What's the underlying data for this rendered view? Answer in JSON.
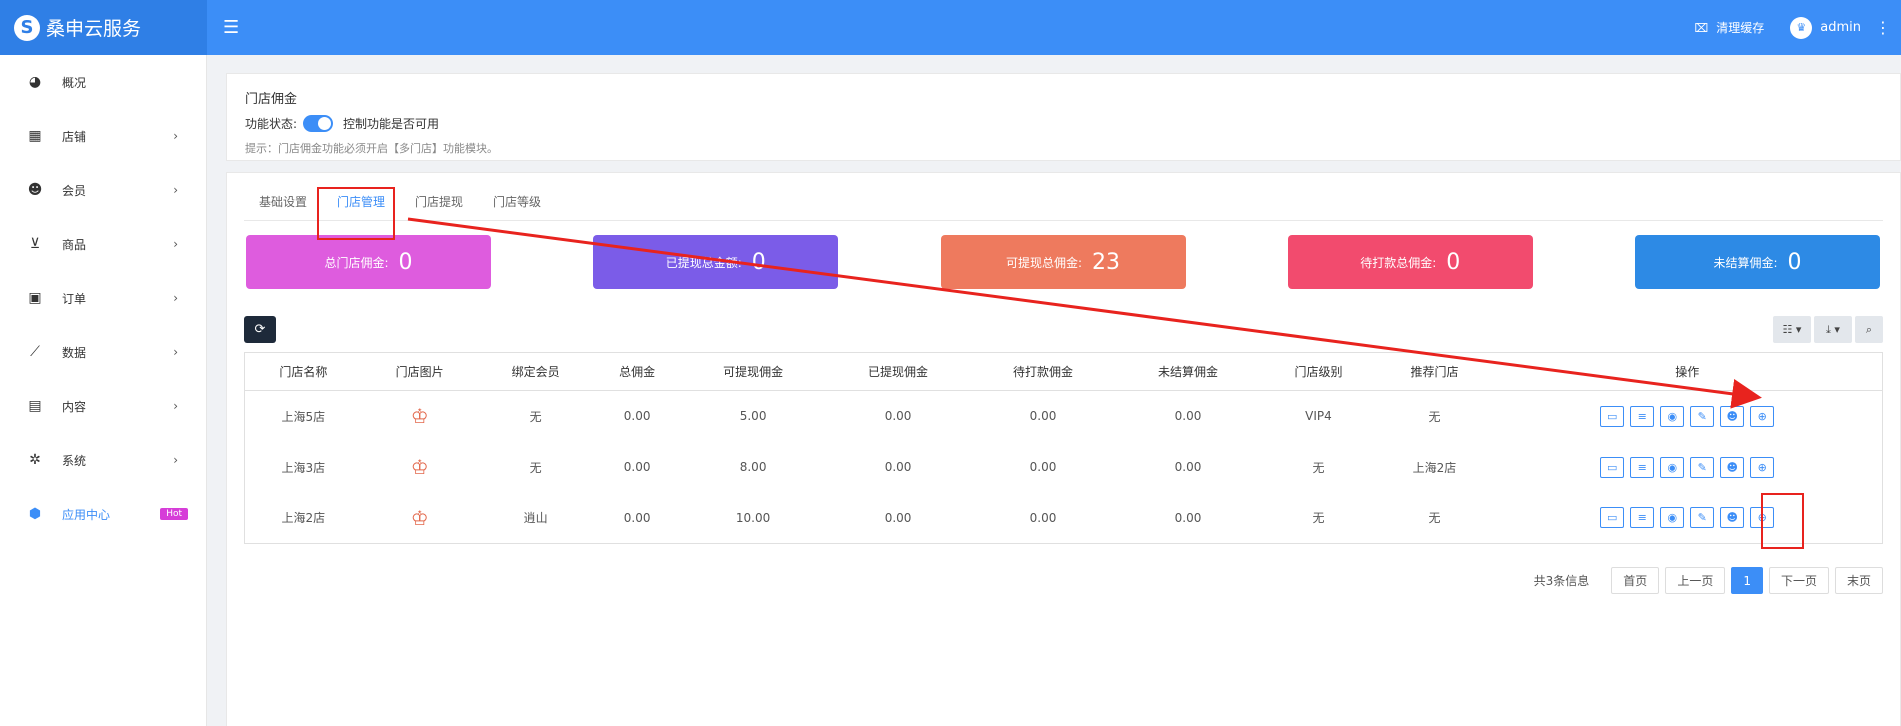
{
  "brand": {
    "name": "桑申云服务",
    "logo_letter": "S"
  },
  "header": {
    "clear_cache": "清理缓存",
    "admin": "admin"
  },
  "sidebar": {
    "items": [
      {
        "label": "概况",
        "icon": "dashboard-icon"
      },
      {
        "label": "店铺",
        "icon": "grid-icon"
      },
      {
        "label": "会员",
        "icon": "users-icon"
      },
      {
        "label": "商品",
        "icon": "cart-icon"
      },
      {
        "label": "订单",
        "icon": "money-icon"
      },
      {
        "label": "数据",
        "icon": "chart-icon"
      },
      {
        "label": "内容",
        "icon": "file-icon"
      },
      {
        "label": "系统",
        "icon": "gear-icon"
      },
      {
        "label": "应用中心",
        "icon": "cube-icon",
        "badge": "Hot"
      }
    ]
  },
  "panel1": {
    "title": "门店佣金",
    "status_label": "功能状态:",
    "status_desc": "控制功能是否可用",
    "hint": "提示：门店佣金功能必须开启【多门店】功能模块。"
  },
  "tabs": [
    "基础设置",
    "门店管理",
    "门店提现",
    "门店等级"
  ],
  "stats": [
    {
      "label": "总门店佣金:",
      "value": "0",
      "color": "#de5cde"
    },
    {
      "label": "已提现总金额:",
      "value": "0",
      "color": "#7b5ce8"
    },
    {
      "label": "可提现总佣金:",
      "value": "23",
      "color": "#ee7a5e"
    },
    {
      "label": "待打款总佣金:",
      "value": "0",
      "color": "#f24b6e"
    },
    {
      "label": "未结算佣金:",
      "value": "0",
      "color": "#2d8ae5"
    }
  ],
  "table": {
    "headers": [
      "门店名称",
      "门店图片",
      "绑定会员",
      "总佣金",
      "可提现佣金",
      "已提现佣金",
      "待打款佣金",
      "未结算佣金",
      "门店级别",
      "推荐门店",
      "操作"
    ],
    "rows": [
      [
        "上海5店",
        "",
        "无",
        "0.00",
        "5.00",
        "0.00",
        "0.00",
        "0.00",
        "VIP4",
        "无"
      ],
      [
        "上海3店",
        "",
        "无",
        "0.00",
        "8.00",
        "0.00",
        "0.00",
        "0.00",
        "无",
        "上海2店"
      ],
      [
        "上海2店",
        "",
        "逍山",
        "0.00",
        "10.00",
        "0.00",
        "0.00",
        "0.00",
        "无",
        "无"
      ]
    ]
  },
  "pager": {
    "info": "共3条信息",
    "first": "首页",
    "prev": "上一页",
    "current": "1",
    "next": "下一页",
    "last": "末页"
  }
}
